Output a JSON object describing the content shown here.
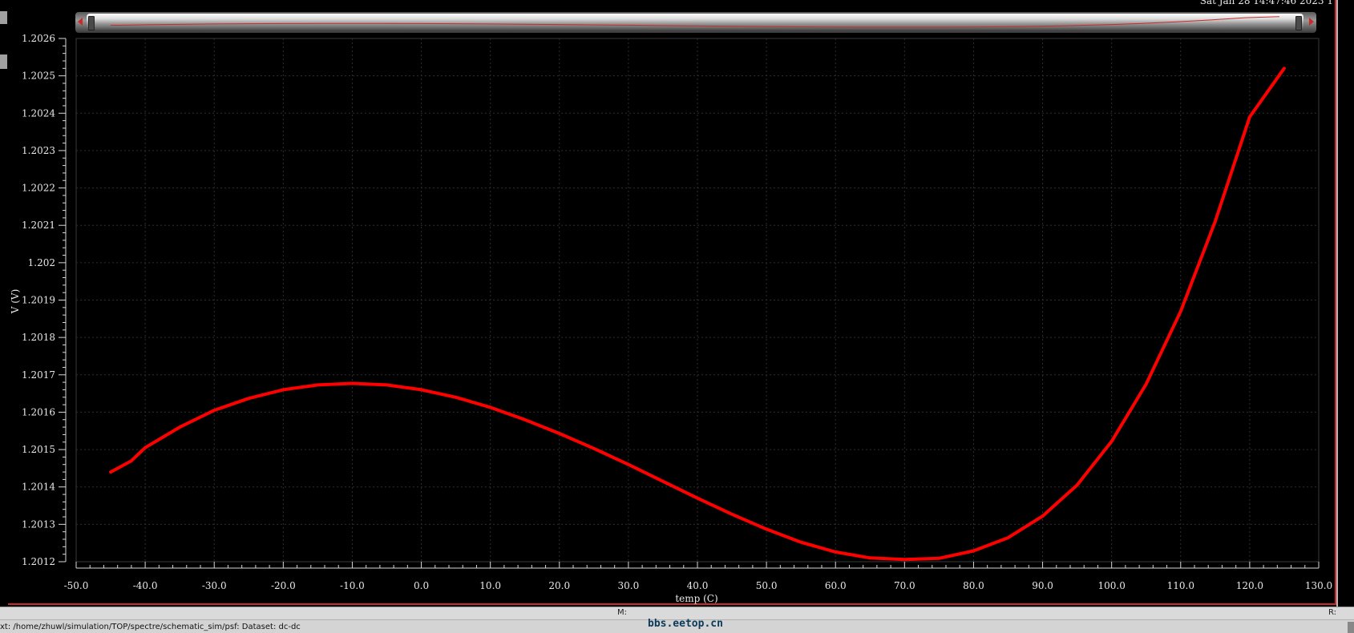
{
  "header": {
    "timestamp": "Sat Jan 28 14:47:46 2023  1"
  },
  "chart_data": {
    "type": "line",
    "title": "",
    "xlabel": "temp (C)",
    "ylabel": "V (V)",
    "xlim": [
      -50,
      130
    ],
    "ylim": [
      1.2012,
      1.2026
    ],
    "x_ticks": [
      "-50.0",
      "-40.0",
      "-30.0",
      "-20.0",
      "-10.0",
      "0.0",
      "10.0",
      "20.0",
      "30.0",
      "40.0",
      "50.0",
      "60.0",
      "70.0",
      "80.0",
      "90.0",
      "100.0",
      "110.0",
      "120.0",
      "130.0"
    ],
    "y_ticks": [
      "1.2012",
      "1.2013",
      "1.2014",
      "1.2015",
      "1.2016",
      "1.2017",
      "1.2018",
      "1.2019",
      "1.202",
      "1.2021",
      "1.2022",
      "1.2023",
      "1.2024",
      "1.2025",
      "1.2026"
    ],
    "grid": true,
    "series": [
      {
        "color": "#ff0000",
        "x": [
          -45,
          -42,
          -40,
          -35,
          -30,
          -25,
          -20,
          -15,
          -10,
          -5,
          0,
          5,
          10,
          15,
          20,
          25,
          30,
          35,
          40,
          45,
          50,
          55,
          60,
          65,
          70,
          75,
          80,
          85,
          90,
          95,
          100,
          105,
          110,
          115,
          120,
          125
        ],
        "y": [
          1.20144,
          1.20147,
          1.201505,
          1.20156,
          1.201605,
          1.201637,
          1.20166,
          1.201673,
          1.201677,
          1.201673,
          1.20166,
          1.20164,
          1.201613,
          1.20158,
          1.201543,
          1.201503,
          1.20146,
          1.201415,
          1.20137,
          1.201327,
          1.201287,
          1.201252,
          1.201226,
          1.20121,
          1.201206,
          1.201209,
          1.201229,
          1.201264,
          1.201322,
          1.201405,
          1.201522,
          1.201675,
          1.20187,
          1.20211,
          1.20239,
          1.20252
        ]
      }
    ]
  },
  "overview": {
    "color": "#cc2a2a"
  },
  "status": {
    "m_label": "M:",
    "r_label": "R:",
    "path_text": "xt: /home/zhuwl/simulation/TOP/spectre/schematic_sim/psf: Dataset: dc-dc",
    "watermark": "bbs.eetop.cn"
  }
}
